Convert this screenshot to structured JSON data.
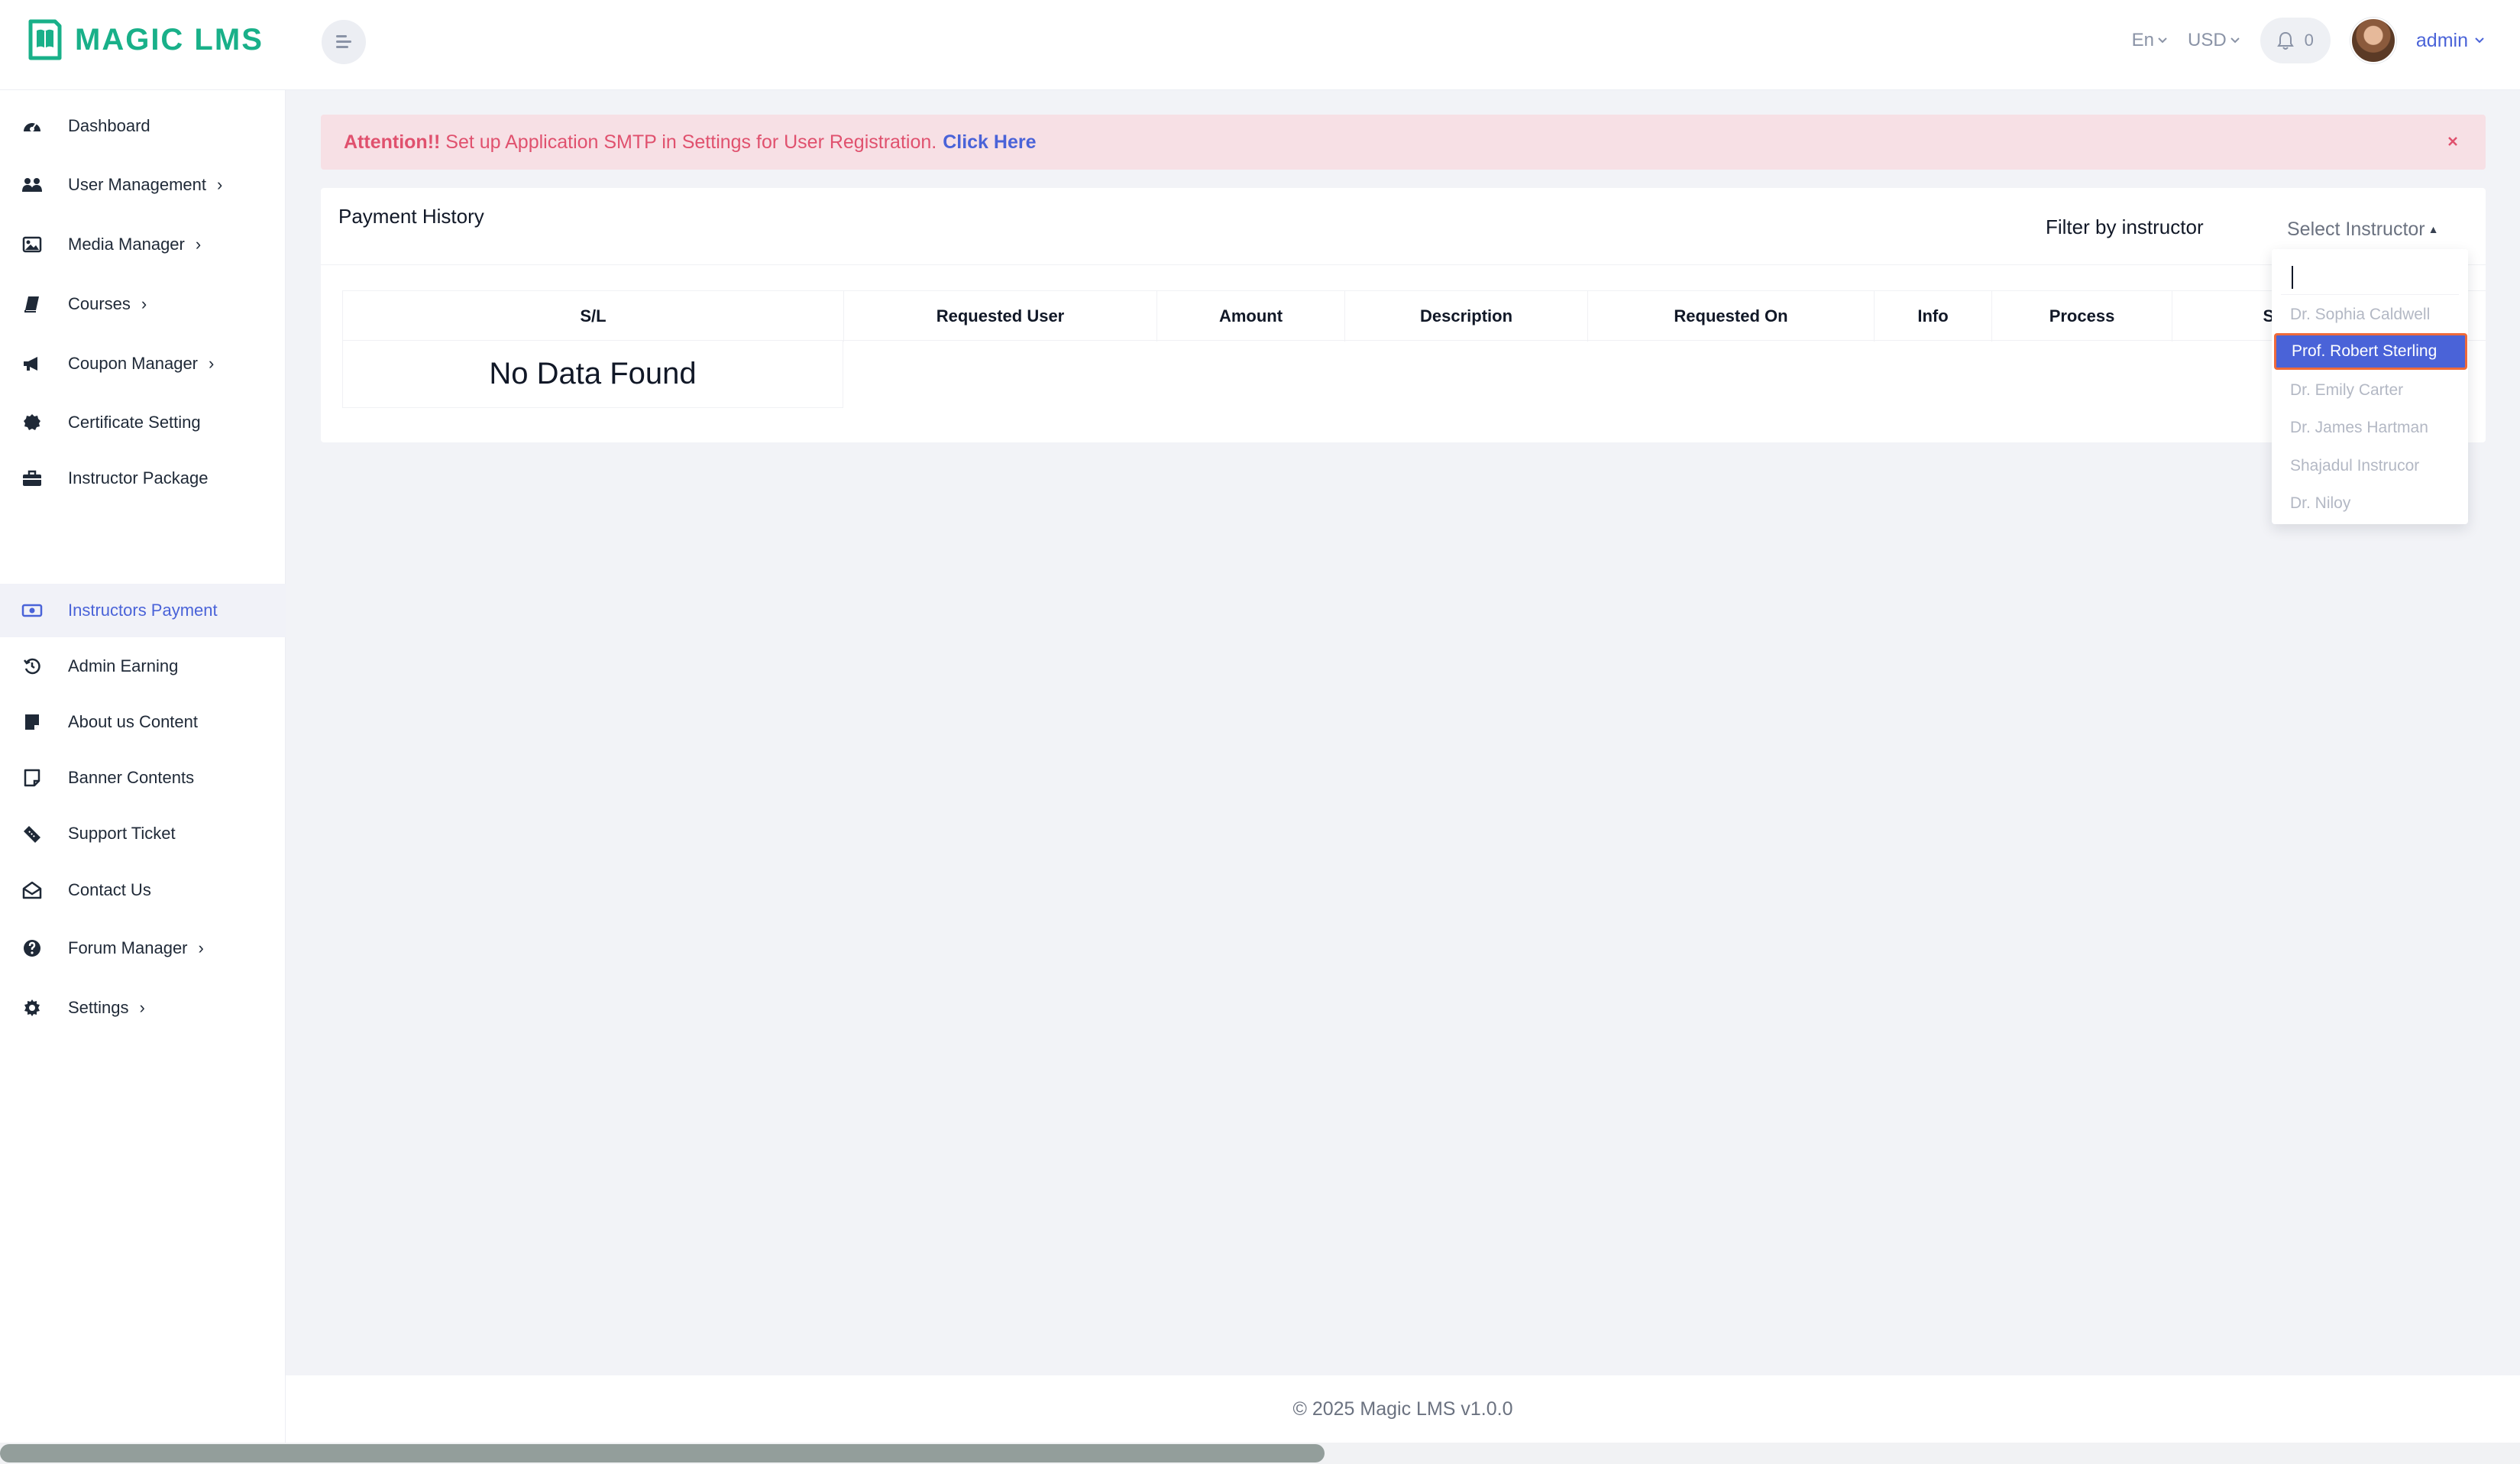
{
  "app": {
    "logo_text": "MAGIC LMS",
    "brand_color": "#19b089",
    "accent_color": "#4a63d8"
  },
  "header": {
    "language": "En",
    "currency": "USD",
    "notification_count": "0",
    "user_name": "admin"
  },
  "sidebar": {
    "items": [
      {
        "label": "Dashboard",
        "icon": "dashboard-icon",
        "has_submenu": false
      },
      {
        "label": "User Management",
        "icon": "users-icon",
        "has_submenu": true
      },
      {
        "label": "Media Manager",
        "icon": "image-icon",
        "has_submenu": true
      },
      {
        "label": "Courses",
        "icon": "book-icon",
        "has_submenu": true
      },
      {
        "label": "Coupon Manager",
        "icon": "megaphone-icon",
        "has_submenu": true
      },
      {
        "label": "Certificate Setting",
        "icon": "certificate-icon",
        "has_submenu": false
      },
      {
        "label": "Instructor Package",
        "icon": "briefcase-icon",
        "has_submenu": false
      },
      {
        "label": "Instructors Payment",
        "icon": "money-icon",
        "has_submenu": false,
        "active": true
      },
      {
        "label": "Admin Earning",
        "icon": "history-icon",
        "has_submenu": false
      },
      {
        "label": "About us Content",
        "icon": "note-icon",
        "has_submenu": false
      },
      {
        "label": "Banner Contents",
        "icon": "sticky-note-icon",
        "has_submenu": false
      },
      {
        "label": "Support Ticket",
        "icon": "ticket-icon",
        "has_submenu": false
      },
      {
        "label": "Contact Us",
        "icon": "envelope-open-icon",
        "has_submenu": false
      },
      {
        "label": "Forum Manager",
        "icon": "question-circle-icon",
        "has_submenu": true
      },
      {
        "label": "Settings",
        "icon": "gear-icon",
        "has_submenu": true
      }
    ]
  },
  "alert": {
    "strong": "Attention!!",
    "message": " Set up Application SMTP in Settings for User Registration.",
    "link": "Click Here"
  },
  "card": {
    "title": "Payment History",
    "filter_label": "Filter by instructor",
    "select_placeholder": "Select Instructor"
  },
  "table": {
    "columns": [
      "S/L",
      "Requested User",
      "Amount",
      "Description",
      "Requested On",
      "Info",
      "Process",
      "St"
    ],
    "empty_text": "No Data Found"
  },
  "dropdown": {
    "search_value": "",
    "options": [
      {
        "label": "Dr. Sophia Caldwell",
        "selected": false
      },
      {
        "label": "Prof. Robert Sterling",
        "selected": true
      },
      {
        "label": "Dr. Emily Carter",
        "selected": false
      },
      {
        "label": "Dr. James Hartman",
        "selected": false
      },
      {
        "label": "Shajadul Instrucor",
        "selected": false
      },
      {
        "label": "Dr. Niloy",
        "selected": false
      }
    ]
  },
  "footer": {
    "text": "© 2025 Magic LMS v1.0.0"
  }
}
